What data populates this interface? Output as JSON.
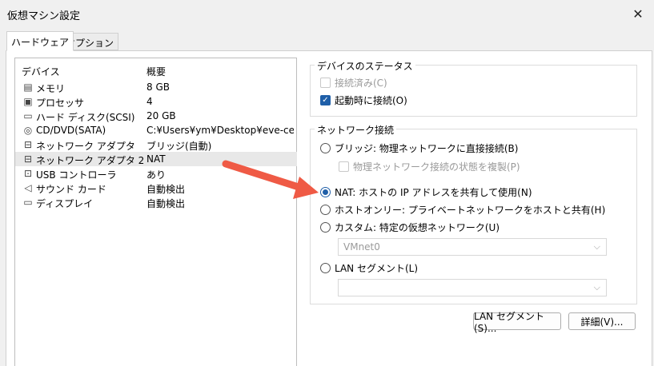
{
  "window": {
    "title": "仮想マシン設定",
    "close_glyph": "✕"
  },
  "tabs": [
    {
      "label": "ハードウェア",
      "active": true
    },
    {
      "label": "オプション",
      "active": false
    }
  ],
  "device_table": {
    "columns": [
      "デバイス",
      "概要"
    ],
    "rows": [
      {
        "icon": "memory-icon",
        "glyph": "▤",
        "name": "メモリ",
        "summary": "8 GB"
      },
      {
        "icon": "processor-icon",
        "glyph": "▣",
        "name": "プロセッサ",
        "summary": "4"
      },
      {
        "icon": "hard-disk-icon",
        "glyph": "▭",
        "name": "ハード ディスク(SCSI)",
        "summary": "20 GB"
      },
      {
        "icon": "cd-dvd-icon",
        "glyph": "◎",
        "name": "CD/DVD(SATA)",
        "summary": "C:¥Users¥ym¥Desktop¥eve-ce-..."
      },
      {
        "icon": "network-adapter-icon",
        "glyph": "⊟",
        "name": "ネットワーク アダプタ",
        "summary": "ブリッジ(自動)"
      },
      {
        "icon": "network-adapter-icon",
        "glyph": "⊟",
        "name": "ネットワーク アダプタ 2",
        "summary": "NAT",
        "selected": true
      },
      {
        "icon": "usb-controller-icon",
        "glyph": "⊡",
        "name": "USB コントローラ",
        "summary": "あり"
      },
      {
        "icon": "sound-card-icon",
        "glyph": "◁",
        "name": "サウンド カード",
        "summary": "自動検出"
      },
      {
        "icon": "display-icon",
        "glyph": "▭",
        "name": "ディスプレイ",
        "summary": "自動検出"
      }
    ]
  },
  "device_status": {
    "title": "デバイスのステータス",
    "connected": {
      "label": "接続済み(C)",
      "checked": false,
      "disabled": true
    },
    "connect_on_power_on": {
      "label": "起動時に接続(O)",
      "checked": true
    }
  },
  "network_connection": {
    "title": "ネットワーク接続",
    "options": [
      {
        "key": "bridged",
        "label": "ブリッジ: 物理ネットワークに直接接続(B)",
        "selected": false
      },
      {
        "key": "nat",
        "label": "NAT: ホストの IP アドレスを共有して使用(N)",
        "selected": true
      },
      {
        "key": "host_only",
        "label": "ホストオンリー: プライベートネットワークをホストと共有(H)",
        "selected": false
      },
      {
        "key": "custom",
        "label": "カスタム: 特定の仮想ネットワーク(U)",
        "selected": false
      },
      {
        "key": "lan_segment",
        "label": "LAN セグメント(L)",
        "selected": false
      }
    ],
    "replicate_state": {
      "label": "物理ネットワーク接続の状態を複製(P)",
      "checked": false,
      "disabled": true
    },
    "custom_select_value": "VMnet0",
    "lan_select_value": ""
  },
  "buttons": {
    "lan_segment": "LAN セグメント(S)...",
    "advanced": "詳細(V)..."
  },
  "colors": {
    "accent": "#1f5fa8",
    "arrow": "#ef5a45"
  }
}
